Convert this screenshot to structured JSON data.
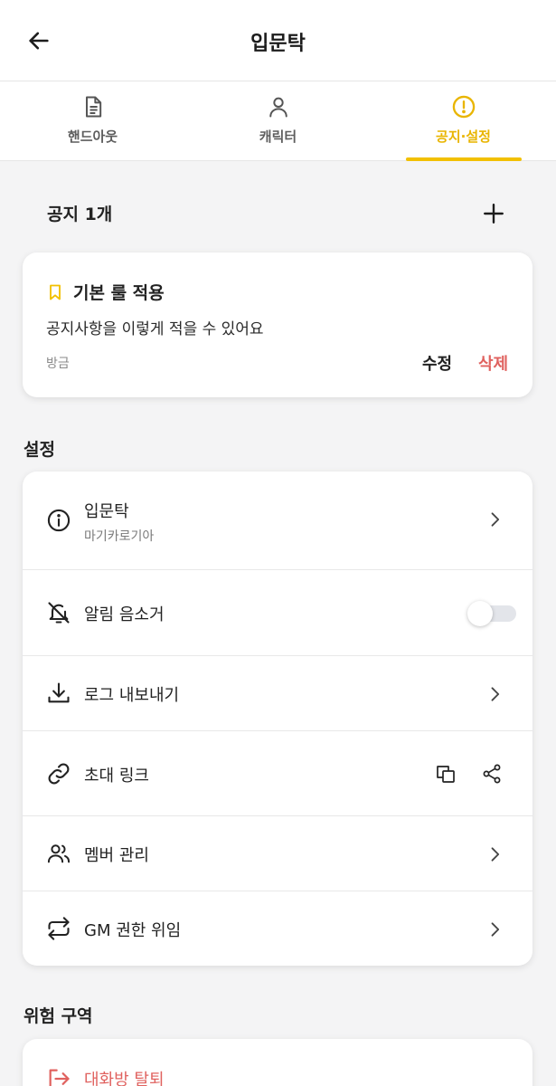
{
  "header": {
    "title": "입문탁"
  },
  "tabs": [
    {
      "label": "핸드아웃",
      "icon": "document-icon",
      "active": false
    },
    {
      "label": "캐릭터",
      "icon": "person-icon",
      "active": false
    },
    {
      "label": "공지·설정",
      "icon": "alert-circle-icon",
      "active": true
    }
  ],
  "notice": {
    "header": "공지 1개",
    "item": {
      "title": "기본 룰 적용",
      "body": "공지사항을 이렇게 적을 수 있어요",
      "time": "방금",
      "edit_label": "수정",
      "delete_label": "삭제"
    }
  },
  "settings": {
    "title": "설정",
    "room": {
      "name": "입문탁",
      "system": "마기카로기아"
    },
    "mute": {
      "label": "알림 음소거",
      "enabled": false
    },
    "export": {
      "label": "로그 내보내기"
    },
    "invite": {
      "label": "초대 링크"
    },
    "members": {
      "label": "멤버 관리"
    },
    "gm": {
      "label": "GM 권한 위임"
    }
  },
  "danger": {
    "title": "위험 구역",
    "leave_label": "대화방 탈퇴"
  },
  "colors": {
    "accent": "#f2c000",
    "danger": "#e0625f",
    "background": "#f4f4f5"
  }
}
